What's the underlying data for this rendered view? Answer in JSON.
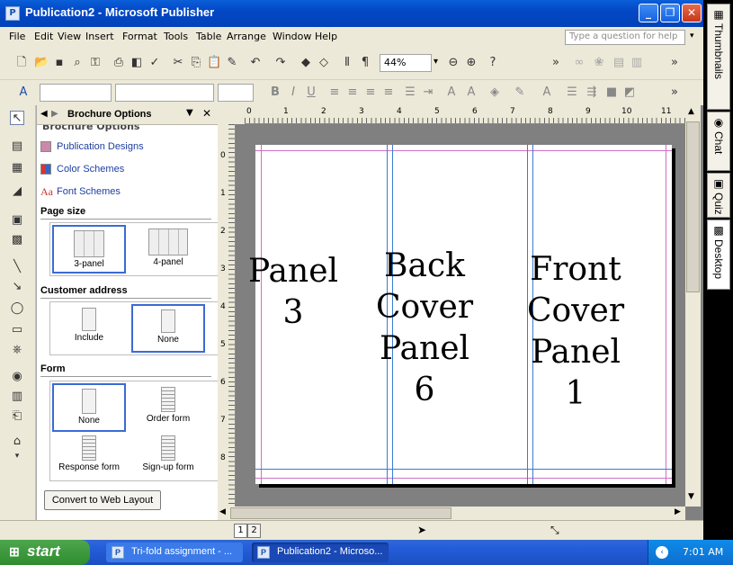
{
  "window": {
    "title": "Publication2 - Microsoft Publisher",
    "app_icon": "publisher-icon"
  },
  "menu": [
    "File",
    "Edit",
    "View",
    "Insert",
    "Format",
    "Tools",
    "Table",
    "Arrange",
    "Window",
    "Help"
  ],
  "help_box": {
    "placeholder": "Type a question for help"
  },
  "toolbar": {
    "zoom": "44%"
  },
  "right_tabs": [
    "Thumbnails",
    "Chat",
    "Quiz",
    "Desktop"
  ],
  "task_pane": {
    "title": "Brochure Options",
    "partial_header": "Brochure Options",
    "links": [
      "Publication Designs",
      "Color Schemes",
      "Font Schemes"
    ],
    "page_size": {
      "heading": "Page size",
      "options": [
        "3-panel",
        "4-panel"
      ],
      "selected": "3-panel"
    },
    "customer_address": {
      "heading": "Customer address",
      "options": [
        "Include",
        "None"
      ],
      "selected": "None"
    },
    "form": {
      "heading": "Form",
      "options": [
        "None",
        "Order form",
        "Response form",
        "Sign-up form"
      ],
      "selected": "None"
    },
    "convert_button": "Convert to Web Layout"
  },
  "rulers": {
    "horizontal": [
      "0",
      "1",
      "2",
      "3",
      "4",
      "5",
      "6",
      "7",
      "8",
      "9",
      "10",
      "11"
    ],
    "vertical": [
      "0",
      "1",
      "2",
      "3",
      "4",
      "5",
      "6",
      "7",
      "8"
    ]
  },
  "panels": [
    {
      "line1": "Panel",
      "line2": "3"
    },
    {
      "line1": "Back",
      "line2": "Cover",
      "line3": "Panel",
      "line4": "6"
    },
    {
      "line1": "Front",
      "line2": "Cover",
      "line3": "Panel",
      "line4": "1"
    }
  ],
  "page_tabs": [
    "1",
    "2"
  ],
  "taskbar": {
    "start": "start",
    "tasks": [
      "Tri-fold assignment - ...",
      "Publication2 - Microso..."
    ],
    "clock": "7:01 AM"
  },
  "colors": {
    "title_bar": "#0348c6",
    "selection": "#3a6bd4",
    "guide": "#3a7bd5"
  }
}
